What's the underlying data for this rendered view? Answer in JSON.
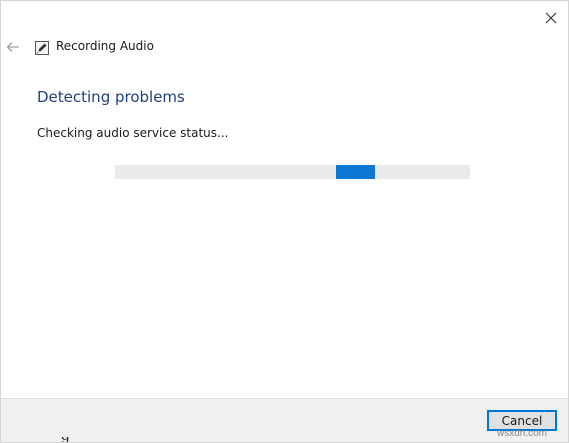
{
  "window": {
    "app_title": "Recording Audio",
    "app_icon": "microphone-icon",
    "close_icon": "close-icon",
    "back_icon": "back-arrow-icon"
  },
  "main": {
    "heading": "Detecting problems",
    "status": "Checking audio service status..."
  },
  "progress": {
    "mode": "indeterminate",
    "chunk_position_fraction": 0.7,
    "track_color": "#eaeaea",
    "fill_color": "#0f78d7"
  },
  "footer": {
    "cancel_label": "Cancel"
  },
  "watermark": {
    "text": "wsxdn.com"
  },
  "colors": {
    "heading": "#1e3f80",
    "accent": "#0078d7"
  }
}
